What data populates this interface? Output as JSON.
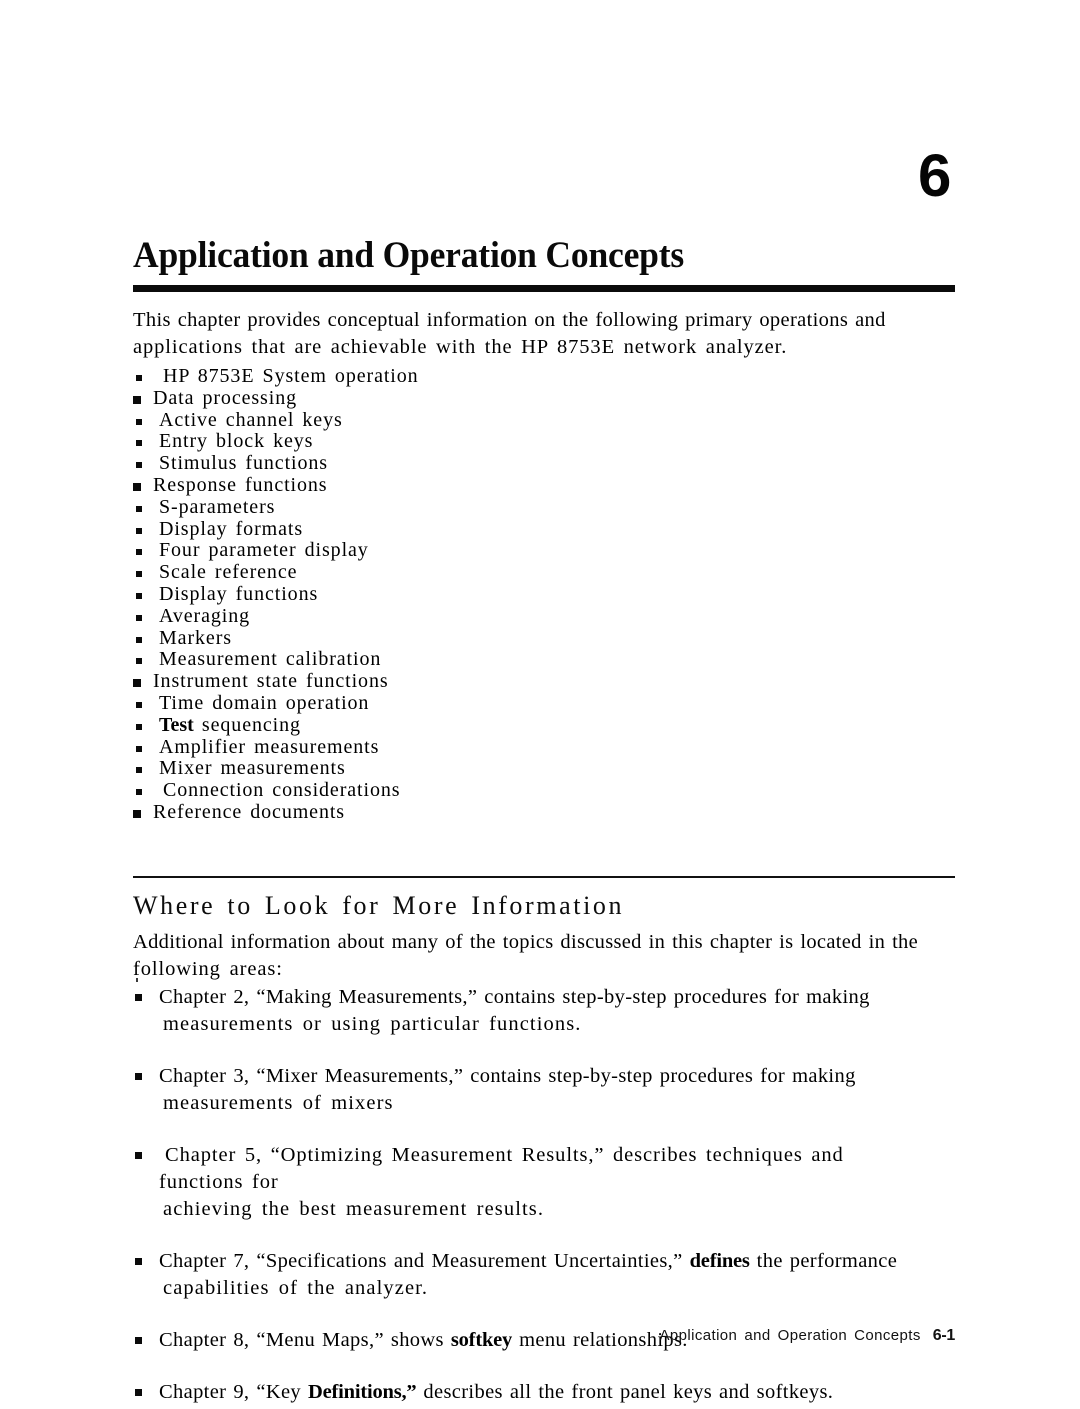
{
  "chapter": {
    "number": "6",
    "title": "Application and Operation Concepts"
  },
  "intro": {
    "line1": "This chapter provides conceptual information on the following primary operations and",
    "line2": "applications that are achievable with the HP 8753E network analyzer."
  },
  "topics": [
    {
      "text": "HP 8753E System operation"
    },
    {
      "text": "Data processing"
    },
    {
      "text": "Active channel keys"
    },
    {
      "text": "Entry block keys"
    },
    {
      "text": "Stimulus functions"
    },
    {
      "text": "Response functions"
    },
    {
      "text": "S-parameters"
    },
    {
      "text": "Display formats"
    },
    {
      "text": "Four parameter display"
    },
    {
      "text": "Scale reference"
    },
    {
      "text": "Display functions"
    },
    {
      "text": "Averaging"
    },
    {
      "text": "Markers"
    },
    {
      "text": "Measurement calibration"
    },
    {
      "text": "Instrument state functions"
    },
    {
      "text": "Time domain operation"
    },
    {
      "text_bold": "Test",
      "text": " sequencing"
    },
    {
      "text": "Amplifier measurements"
    },
    {
      "text": "Mixer measurements"
    },
    {
      "text": "Connection considerations"
    },
    {
      "text": "Reference documents"
    }
  ],
  "section": {
    "heading": "Where to Look for More Information",
    "intro_line1": "Additional information about many of the topics discussed in this chapter is located in the",
    "intro_line2": "following areas:",
    "references": [
      {
        "lead": "Chapter 2, “Making Measurements,” contains step-by-step procedures for making",
        "cont": "measurements or using particular functions."
      },
      {
        "lead": "Chapter 3, “Mixer Measurements,” contains step-by-step procedures for making",
        "cont": "measurements of mixers"
      },
      {
        "lead": "Chapter 5, “Optimizing Measurement Results,” describes techniques and functions for",
        "cont": "achieving the best measurement results."
      },
      {
        "lead_pre": "Chapter 7, “Specifications and Measurement Uncertainties,” ",
        "lead_bold": "defines",
        "lead_post": " the performance",
        "cont": "capabilities of the analyzer."
      },
      {
        "lead_pre": "Chapter 8, “Menu Maps,” shows ",
        "lead_bold": "softkey",
        "lead_post": " menu relationships.",
        "cont": ""
      },
      {
        "lead_pre": "Chapter 9, “Key ",
        "lead_bold": "Definitions,”",
        "lead_post": " describes all the front panel keys and softkeys.",
        "cont": ""
      }
    ]
  },
  "footer": {
    "text": "Application and Operation Concepts",
    "page": "6-1"
  },
  "colors": {
    "ink": "#0a0a0a",
    "paper": "#ffffff"
  }
}
